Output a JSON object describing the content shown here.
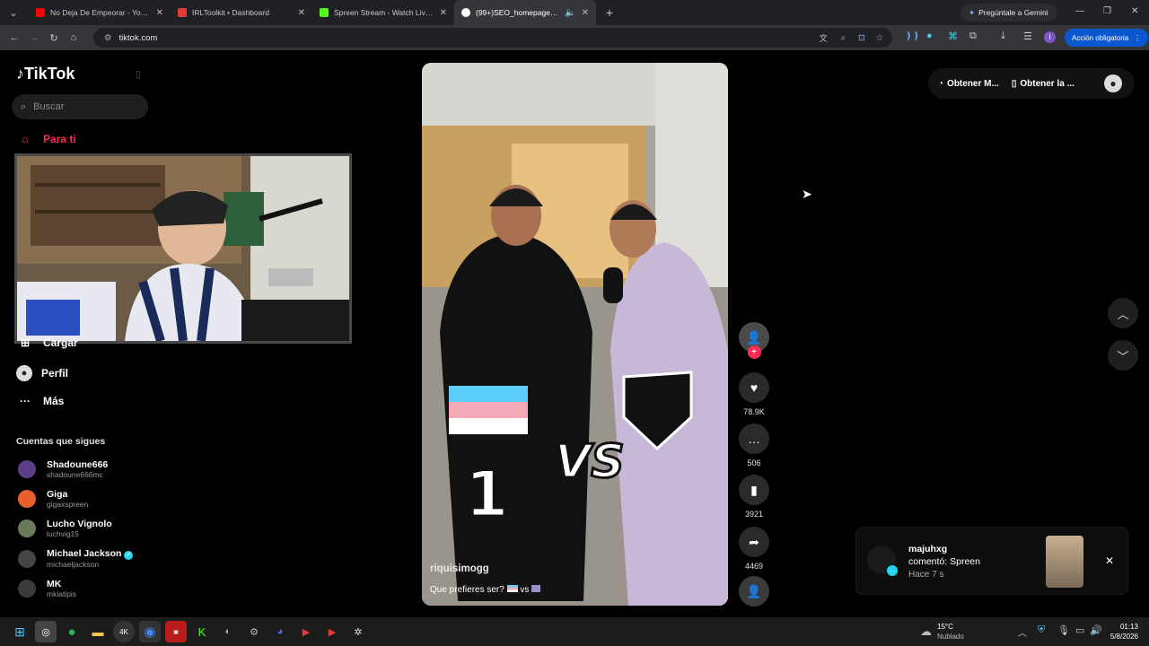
{
  "browser": {
    "tabs": [
      {
        "title": "No Deja De Empeorar - YouTub",
        "favicon_color": "#ff0000"
      },
      {
        "title": "IRLToolkit • Dashboard",
        "favicon_color": "#e53935"
      },
      {
        "title": "Spreen Stream - Watch Live on",
        "favicon_color": "#53fc18"
      },
      {
        "title": "(99+)SEO_homepage_title",
        "favicon_color": "#ffffff"
      }
    ],
    "gemini_label": "Pregúntale a Gemini",
    "address": "tiktok.com",
    "action_label": "Acción obligatoria"
  },
  "tiktok": {
    "logo": "TikTok",
    "search_placeholder": "Buscar",
    "nav": [
      {
        "label": "Para ti",
        "icon": "home-icon",
        "active": true
      },
      {
        "label": "Cargar",
        "icon": "upload-icon"
      },
      {
        "label": "Perfil",
        "icon": "profile-icon"
      },
      {
        "label": "Más",
        "icon": "more-icon"
      }
    ],
    "following_title": "Cuentas que sigues",
    "following": [
      {
        "name": "Shadoune666",
        "handle": "shadoune666mc",
        "color": "#5a3e8a"
      },
      {
        "name": "Giga",
        "handle": "gigaxspreen",
        "color": "#e8602c"
      },
      {
        "name": "Lucho Vignolo",
        "handle": "luchvig15",
        "color": "#6a7a5a"
      },
      {
        "name": "Michael Jackson",
        "handle": "michaeljackson",
        "color": "#444444",
        "verified": true
      },
      {
        "name": "MK",
        "handle": "mkiatipis",
        "color": "#3a3a3a"
      }
    ],
    "video": {
      "author": "riquisimogg",
      "caption": "Que prefieres ser?",
      "caption_vs": "vs",
      "overlay_number": "1",
      "overlay_vs": "VS"
    },
    "actions": {
      "likes": "78.9K",
      "comments": "506",
      "saves": "3921",
      "shares": "4469"
    },
    "top_buttons": [
      "Obtener M...",
      "Obtener la ..."
    ],
    "notification": {
      "user": "majuhxg",
      "text": "comentó: Spreen",
      "time": "Hace 7 s"
    }
  },
  "taskbar": {
    "temp": "15°C",
    "weather": "Nublado",
    "time": "01:13",
    "date": "5/8/2026"
  }
}
